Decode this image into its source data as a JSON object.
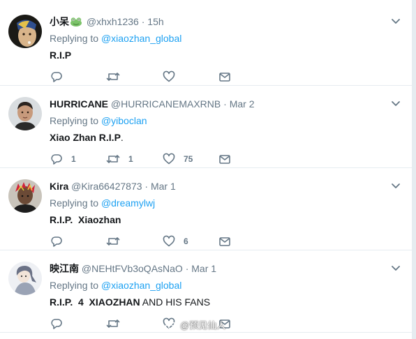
{
  "tweets": [
    {
      "name": "小呆",
      "handle": "@xhxh1236",
      "time": "15h",
      "replying_prefix": "Replying to",
      "mention": "@xiaozhan_global",
      "text_bold": "R.I.P",
      "text_rest": "",
      "reply_count": "",
      "retweet_count": "",
      "like_count": ""
    },
    {
      "name": "HURRICANE",
      "handle": "@HURRICANEMAXRNB",
      "time": "Mar 2",
      "replying_prefix": "Replying to",
      "mention": "@yiboclan",
      "text_bold": "Xiao Zhan R.I.P",
      "text_rest": ".",
      "reply_count": "1",
      "retweet_count": "1",
      "like_count": "75"
    },
    {
      "name": "Kira",
      "handle": "@Kira66427873",
      "time": "Mar 1",
      "replying_prefix": "Replying to",
      "mention": "@dreamylwj",
      "text_bold": "R.I.P.  Xiaozhan",
      "text_rest": "",
      "reply_count": "",
      "retweet_count": "",
      "like_count": "6"
    },
    {
      "name": "映江南",
      "handle": "@NEHtFVb3oQAsNaO",
      "time": "Mar 1",
      "replying_prefix": "Replying to",
      "mention": "@xiaozhan_global",
      "text_bold": "R.I.P.  4  XIAOZHAN",
      "text_rest": " AND HIS FANS",
      "reply_count": "",
      "retweet_count": "",
      "like_count": ""
    }
  ],
  "separator": "·",
  "watermark": "@预见仙人",
  "colors": {
    "link": "#1da1f2",
    "muted": "#657786",
    "text": "#14171a",
    "divider": "#e6ecf0"
  },
  "icons": [
    "reply-icon",
    "retweet-icon",
    "like-icon",
    "direct-message-icon",
    "chevron-down-icon",
    "frog-emoji-icon",
    "weibo-logo-icon"
  ]
}
